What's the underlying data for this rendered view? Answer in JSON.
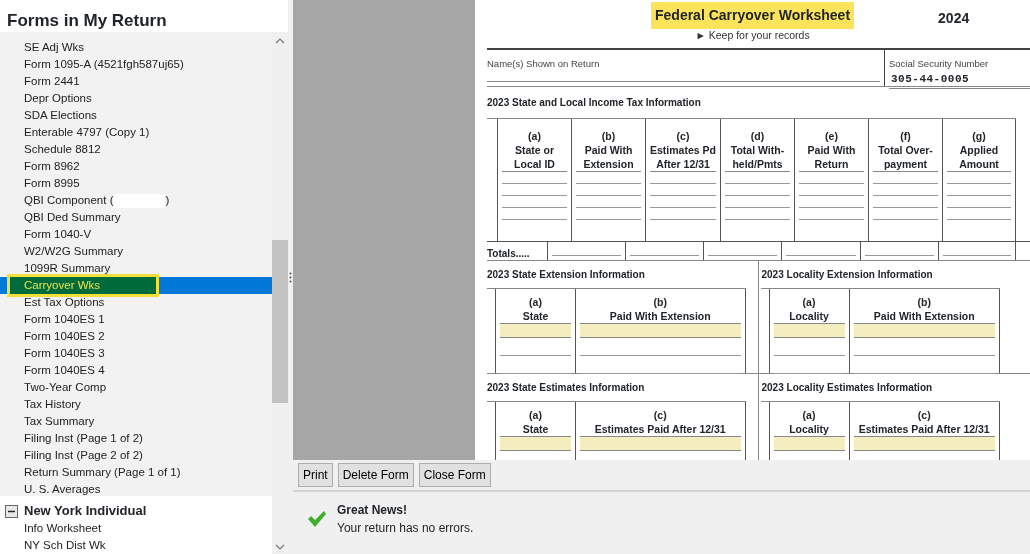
{
  "sidebar": {
    "title": "Forms in My Return",
    "items": [
      {
        "label": "SE Adj Wks",
        "selected": false,
        "highlighted": false
      },
      {
        "label": "Form 1095-A (4521fgh587uj65)",
        "selected": false,
        "highlighted": false
      },
      {
        "label": "Form 2441",
        "selected": false,
        "highlighted": false
      },
      {
        "label": "Depr Options",
        "selected": false,
        "highlighted": false
      },
      {
        "label": "SDA Elections",
        "selected": false,
        "highlighted": false
      },
      {
        "label": "Enterable 4797 (Copy 1)",
        "selected": false,
        "highlighted": false
      },
      {
        "label": "Schedule 8812",
        "selected": false,
        "highlighted": false
      },
      {
        "label": "Form 8962",
        "selected": false,
        "highlighted": false
      },
      {
        "label": "Form 8995",
        "selected": false,
        "highlighted": false
      },
      {
        "label": "QBI Component (",
        "label_end": ")",
        "kind": "redacted",
        "selected": false,
        "highlighted": false
      },
      {
        "label": "QBI Ded Summary",
        "selected": false,
        "highlighted": false
      },
      {
        "label": "Form 1040-V",
        "selected": false,
        "highlighted": false
      },
      {
        "label": "W2/W2G Summary",
        "selected": false,
        "highlighted": false
      },
      {
        "label": "1099R Summary",
        "selected": false,
        "highlighted": false
      },
      {
        "label": "Carryover Wks",
        "selected": true,
        "highlighted": true
      },
      {
        "label": "Est Tax Options",
        "selected": false,
        "highlighted": false
      },
      {
        "label": "Form 1040ES 1",
        "selected": false,
        "highlighted": false
      },
      {
        "label": "Form 1040ES 2",
        "selected": false,
        "highlighted": false
      },
      {
        "label": "Form 1040ES 3",
        "selected": false,
        "highlighted": false
      },
      {
        "label": "Form 1040ES 4",
        "selected": false,
        "highlighted": false
      },
      {
        "label": "Two-Year Comp",
        "selected": false,
        "highlighted": false
      },
      {
        "label": "Tax History",
        "selected": false,
        "highlighted": false
      },
      {
        "label": "Tax Summary",
        "selected": false,
        "highlighted": false
      },
      {
        "label": "Filing Inst (Page 1 of 2)",
        "selected": false,
        "highlighted": false
      },
      {
        "label": "Filing Inst (Page 2 of 2)",
        "selected": false,
        "highlighted": false
      },
      {
        "label": "Return Summary (Page 1 of 1)",
        "selected": false,
        "highlighted": false
      },
      {
        "label": "U. S. Averages",
        "selected": false,
        "highlighted": false
      }
    ],
    "groups": [
      {
        "title": "New York Individual",
        "expanded": true,
        "items": [
          {
            "label": "Info Worksheet"
          },
          {
            "label": "NY Sch Dist Wk"
          }
        ]
      }
    ]
  },
  "form": {
    "title": "Federal Carryover Worksheet",
    "year": "2024",
    "subtitle": "► Keep for your records",
    "name_label": "Name(s) Shown on Return",
    "ssn_label": "Social Security Number",
    "ssn": "305-44-0005",
    "main_table": {
      "heading": "2023 State and Local Income Tax Information",
      "columns": [
        {
          "letter": "(a)",
          "label": "State or\nLocal ID"
        },
        {
          "letter": "(b)",
          "label": "Paid With\nExtension"
        },
        {
          "letter": "(c)",
          "label": "Estimates Pd\nAfter 12/31"
        },
        {
          "letter": "(d)",
          "label": "Total With-\nheld/Pmts"
        },
        {
          "letter": "(e)",
          "label": "Paid With\nReturn"
        },
        {
          "letter": "(f)",
          "label": "Total Over-\npayment"
        },
        {
          "letter": "(g)",
          "label": "Applied\nAmount"
        }
      ],
      "totals_label": "Totals....."
    },
    "small_tables": [
      {
        "heading": "2023 State Extension Information",
        "columns": [
          {
            "letter": "(a)",
            "label": "State"
          },
          {
            "letter": "(b)",
            "label": "Paid With Extension"
          }
        ]
      },
      {
        "heading": "2023 Locality Extension Information",
        "columns": [
          {
            "letter": "(a)",
            "label": "Locality"
          },
          {
            "letter": "(b)",
            "label": "Paid With Extension"
          }
        ]
      },
      {
        "heading": "2023 State Estimates Information",
        "columns": [
          {
            "letter": "(a)",
            "label": "State"
          },
          {
            "letter": "(c)",
            "label": "Estimates Paid After 12/31"
          }
        ]
      },
      {
        "heading": "2023 Locality Estimates Information",
        "columns": [
          {
            "letter": "(a)",
            "label": "Locality"
          },
          {
            "letter": "(c)",
            "label": "Estimates Paid After 12/31"
          }
        ]
      }
    ]
  },
  "buttons": [
    "Print",
    "Delete Form",
    "Close Form"
  ],
  "status": {
    "title": "Great News!",
    "message": "Your return has no errors."
  }
}
